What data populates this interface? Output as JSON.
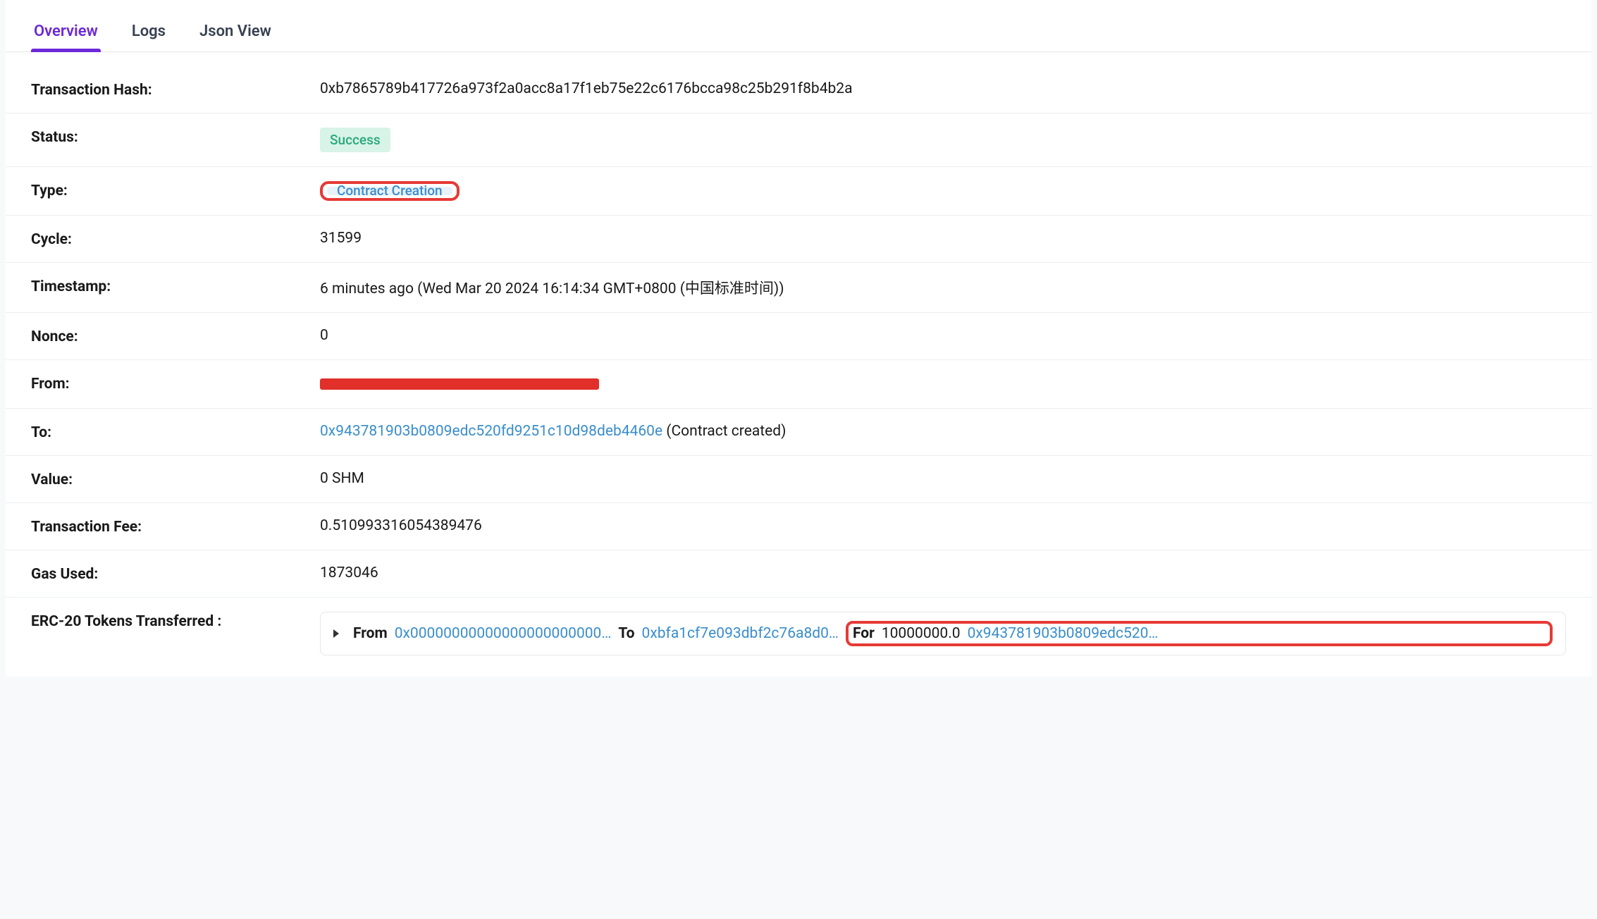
{
  "tabs": {
    "overview": "Overview",
    "logs": "Logs",
    "json_view": "Json View"
  },
  "labels": {
    "transaction_hash": "Transaction Hash:",
    "status": "Status:",
    "type": "Type:",
    "cycle": "Cycle:",
    "timestamp": "Timestamp:",
    "nonce": "Nonce:",
    "from": "From:",
    "to": "To:",
    "value": "Value:",
    "transaction_fee": "Transaction Fee:",
    "gas_used": "Gas Used:",
    "erc20": "ERC-20 Tokens Transferred :"
  },
  "values": {
    "transaction_hash": "0xb7865789b417726a973f2a0acc8a17f1eb75e22c6176bcca98c25b291f8b4b2a",
    "status": "Success",
    "type": "Contract Creation",
    "cycle": "31599",
    "timestamp": "6 minutes ago (Wed Mar 20 2024 16:14:34 GMT+0800 (中国标准时间))",
    "nonce": "0",
    "to_address": "0x943781903b0809edc520fd9251c10d98deb4460e",
    "to_suffix": " (Contract created)",
    "value": "0 SHM",
    "transaction_fee": "0.510993316054389476",
    "gas_used": "1873046"
  },
  "transfer": {
    "from_label": "From",
    "from_addr": "0x00000000000000000000000…",
    "to_label": "To",
    "to_addr": "0xbfa1cf7e093dbf2c76a8d0…",
    "for_label": "For",
    "amount": "10000000.0",
    "token_addr": "0x943781903b0809edc520…"
  }
}
